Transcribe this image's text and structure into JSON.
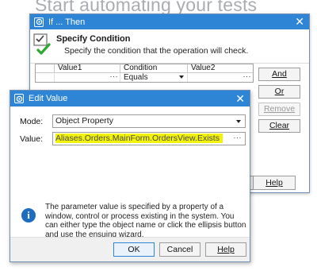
{
  "background": {
    "heading": "Start automating your tests"
  },
  "outer_dialog": {
    "title": "If ... Then",
    "close_glyph": "✕",
    "header_title": "Specify Condition",
    "header_subtitle": "Specify the condition that the operation will check.",
    "grid": {
      "columns": [
        "Value1",
        "Condition",
        "Value2"
      ],
      "row": {
        "value1_button": "···",
        "condition": "Equals",
        "value2_button": "···"
      }
    },
    "buttons": {
      "and": "And",
      "or": "Or",
      "remove": "Remove",
      "clear": "Clear",
      "help": "Help"
    }
  },
  "edit_dialog": {
    "title": "Edit Value",
    "close_glyph": "✕",
    "mode_label": "Mode:",
    "mode_value": "Object Property",
    "value_label": "Value:",
    "value_text": "Aliases.Orders.MainForm.OrdersView.Exists",
    "value_button": "···",
    "info_text": "The parameter value is specified by a property of a window, control or process existing in the system. You can either type the object name or click the ellipsis button and use the ensuing wizard.",
    "buttons": {
      "ok": "OK",
      "cancel": "Cancel",
      "help": "Help"
    }
  },
  "colors": {
    "titlebar": "#2e85d6",
    "highlight": "#f2f20a",
    "info_icon": "#1e6cc0"
  }
}
